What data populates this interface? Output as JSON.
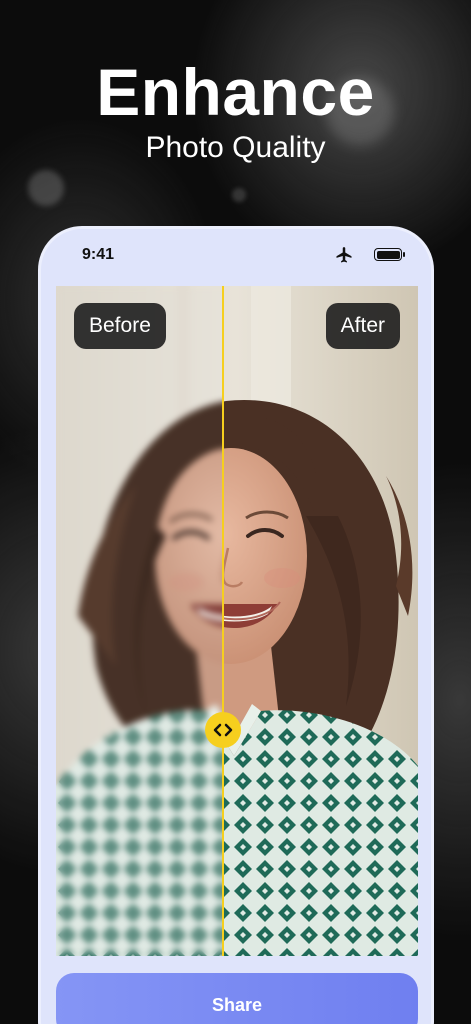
{
  "hero": {
    "title": "Enhance",
    "subtitle": "Photo Quality"
  },
  "status_bar": {
    "time": "9:41",
    "icons": [
      "airplane-icon",
      "battery-icon"
    ]
  },
  "comparison": {
    "before_label": "Before",
    "after_label": "After",
    "handle_icon": "chevron-left-right-icon",
    "accent_color": "#f6cf1e"
  },
  "share_button": {
    "label": "Share",
    "color": "#7b8bf3"
  },
  "colors": {
    "background": "#0c0c0c",
    "phone_frame": "#dfe4fb"
  }
}
